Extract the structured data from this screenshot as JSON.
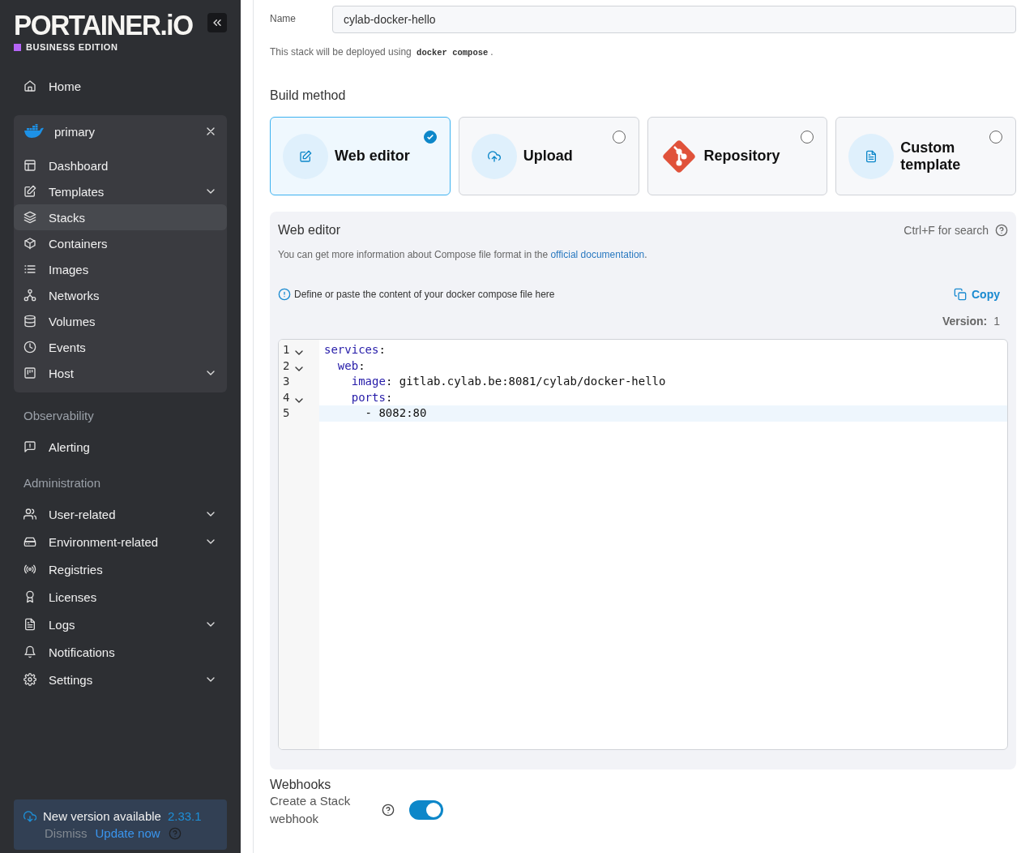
{
  "logo": {
    "name": "PORTAINER.iO",
    "edition": "BUSINESS EDITION"
  },
  "sidebar": {
    "home": {
      "label": "Home",
      "selected": false,
      "expandable": false
    },
    "environment": {
      "name": "primary",
      "items": [
        {
          "label": "Dashboard",
          "selected": false,
          "expandable": false
        },
        {
          "label": "Templates",
          "selected": false,
          "expandable": true
        },
        {
          "label": "Stacks",
          "selected": true,
          "expandable": false
        },
        {
          "label": "Containers",
          "selected": false,
          "expandable": false
        },
        {
          "label": "Images",
          "selected": false,
          "expandable": false
        },
        {
          "label": "Networks",
          "selected": false,
          "expandable": false
        },
        {
          "label": "Volumes",
          "selected": false,
          "expandable": false
        },
        {
          "label": "Events",
          "selected": false,
          "expandable": false
        },
        {
          "label": "Host",
          "selected": false,
          "expandable": true
        }
      ]
    },
    "sections": [
      {
        "title": "Observability",
        "items": [
          {
            "label": "Alerting",
            "selected": false,
            "expandable": false
          }
        ]
      },
      {
        "title": "Administration",
        "items": [
          {
            "label": "User-related",
            "selected": false,
            "expandable": true
          },
          {
            "label": "Environment-related",
            "selected": false,
            "expandable": true
          },
          {
            "label": "Registries",
            "selected": false,
            "expandable": false
          },
          {
            "label": "Licenses",
            "selected": false,
            "expandable": false
          },
          {
            "label": "Logs",
            "selected": false,
            "expandable": true
          },
          {
            "label": "Notifications",
            "selected": false,
            "expandable": false
          },
          {
            "label": "Settings",
            "selected": false,
            "expandable": true
          }
        ]
      }
    ]
  },
  "update_notice": {
    "text": "New version available",
    "version": "2.33.1",
    "dismiss": "Dismiss",
    "update": "Update now"
  },
  "form": {
    "name_label": "Name",
    "name_value": "cylab-docker-hello",
    "deploy_hint": {
      "before": "This stack will be deployed using",
      "code": "docker compose",
      "after": "."
    },
    "build_method": {
      "title": "Build method",
      "options": [
        {
          "label": "Web editor",
          "selected": true
        },
        {
          "label": "Upload",
          "selected": false
        },
        {
          "label": "Repository",
          "selected": false
        },
        {
          "label": "Custom template",
          "selected": false
        }
      ]
    },
    "web_editor": {
      "title": "Web editor",
      "search_hint": "Ctrl+F for search",
      "description": "You can get more information about Compose file format in the",
      "link": "official documentation",
      "description_end": ".",
      "info": "Define or paste the content of your docker compose file here",
      "copy": "Copy",
      "version_label": "Version:",
      "version_value": "1",
      "lines": [
        {
          "number": "1",
          "foldable": true,
          "active": false,
          "code": "services:"
        },
        {
          "number": "2",
          "foldable": true,
          "active": false,
          "code": "  web:"
        },
        {
          "number": "3",
          "foldable": false,
          "active": false,
          "code": "    image: gitlab.cylab.be:8081/cylab/docker-hello"
        },
        {
          "number": "4",
          "foldable": true,
          "active": false,
          "code": "    ports:"
        },
        {
          "number": "5",
          "foldable": false,
          "active": true,
          "code": "      - 8082:80"
        }
      ]
    },
    "webhooks": {
      "title": "Webhooks",
      "label": "Create a Stack webhook",
      "on": true
    }
  }
}
